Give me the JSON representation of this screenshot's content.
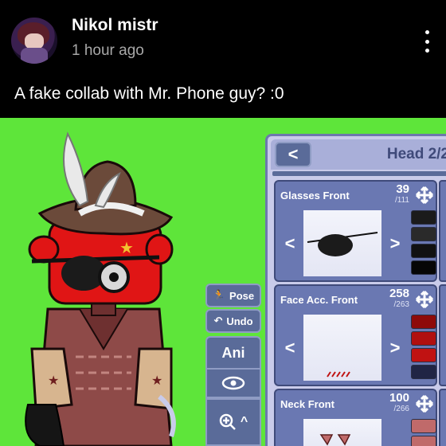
{
  "post": {
    "username": "Nikol mistr",
    "timestamp": "1 hour ago",
    "caption": "A fake collab with Mr. Phone guy? :0"
  },
  "editor": {
    "toolbar": {
      "pose_label": "Pose",
      "undo_label": "Undo",
      "ani_label": "Ani"
    },
    "panel": {
      "back_label": "<",
      "title": "Head 2/2",
      "categories": [
        {
          "name": "Glasses Front",
          "current": "39",
          "total": "/111",
          "swatches": [
            "#1b1b1b",
            "#2a2a2a",
            "#111111",
            "#060606"
          ]
        },
        {
          "name": "Face Acc. Front",
          "current": "258",
          "total": "/263",
          "swatches": [
            "#8e0a0a",
            "#b00f0f",
            "#c01212",
            "#202545"
          ]
        },
        {
          "name": "Neck Front",
          "current": "100",
          "total": "/266",
          "swatches": [
            "#c06a6a",
            "#c06a6a"
          ]
        }
      ],
      "arrow_left": "<",
      "arrow_right": ">"
    }
  },
  "icons": {
    "more": "vertical-ellipsis-icon",
    "pose": "person-pose-icon",
    "undo": "undo-arrow-icon",
    "eye": "eye-icon",
    "zoom": "zoom-in-icon",
    "move": "move-arrows-icon"
  },
  "colors": {
    "background": "#000000",
    "image_green": "#5ee53a",
    "panel": "#c9cbea",
    "panel_accent": "#6a78b2",
    "button": "#5a6b99"
  }
}
